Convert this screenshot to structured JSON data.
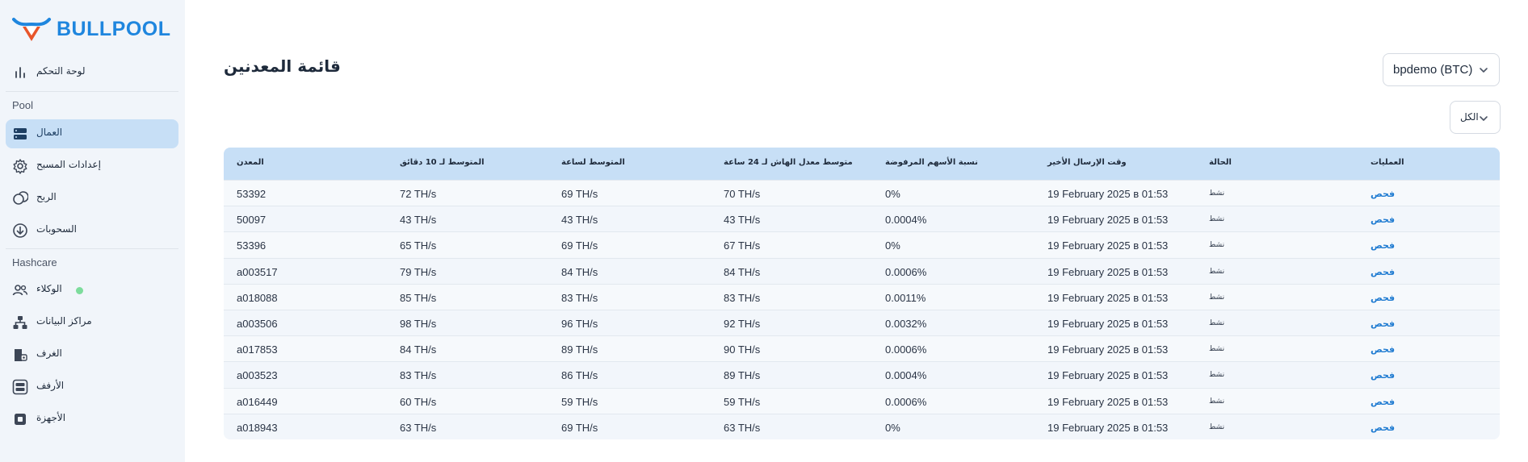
{
  "brand": {
    "name": "BULLPOOL"
  },
  "sidebar": {
    "dashboard": "لوحة التحكم",
    "pool_section": "Pool",
    "pool_items": [
      {
        "label": "العمال",
        "icon": "workers-icon",
        "active": true
      },
      {
        "label": "إعدادات المسبح",
        "icon": "gear-icon",
        "active": false
      },
      {
        "label": "الربح",
        "icon": "coins-icon",
        "active": false
      },
      {
        "label": "السحوبات",
        "icon": "download-circle-icon",
        "active": false
      }
    ],
    "hashcare_section": "Hashcare",
    "hashcare_items": [
      {
        "label": "الوكلاء",
        "icon": "users-icon",
        "status": "online"
      },
      {
        "label": "مراكز البيانات",
        "icon": "datacenter-icon"
      },
      {
        "label": "الغرف",
        "icon": "room-icon"
      },
      {
        "label": "الأرفف",
        "icon": "rack-icon"
      },
      {
        "label": "الأجهزة",
        "icon": "chip-icon"
      }
    ]
  },
  "header": {
    "title": "قائمة المعدنين",
    "pool_select": "bpdemo (BTC)",
    "filter_select": "الكل"
  },
  "table": {
    "columns": [
      "المعدن",
      "المتوسط لـ 10 دقائق",
      "المتوسط لساعة",
      "متوسط معدل الهاش لـ 24 ساعة",
      "نسبة الأسهم المرفوضة",
      "وقت الإرسال الأخير",
      "الحالة",
      "العمليات"
    ],
    "rows": [
      [
        "53392",
        "72 TH/s",
        "69 TH/s",
        "70 TH/s",
        "0%",
        "19 February 2025 в 01:53",
        "نشط",
        "فحص"
      ],
      [
        "50097",
        "43 TH/s",
        "43 TH/s",
        "43 TH/s",
        "0.0004%",
        "19 February 2025 в 01:53",
        "نشط",
        "فحص"
      ],
      [
        "53396",
        "65 TH/s",
        "69 TH/s",
        "67 TH/s",
        "0%",
        "19 February 2025 в 01:53",
        "نشط",
        "فحص"
      ],
      [
        "a003517",
        "79 TH/s",
        "84 TH/s",
        "84 TH/s",
        "0.0006%",
        "19 February 2025 в 01:53",
        "نشط",
        "فحص"
      ],
      [
        "a018088",
        "85 TH/s",
        "83 TH/s",
        "83 TH/s",
        "0.0011%",
        "19 February 2025 в 01:53",
        "نشط",
        "فحص"
      ],
      [
        "a003506",
        "98 TH/s",
        "96 TH/s",
        "92 TH/s",
        "0.0032%",
        "19 February 2025 в 01:53",
        "نشط",
        "فحص"
      ],
      [
        "a017853",
        "84 TH/s",
        "89 TH/s",
        "90 TH/s",
        "0.0006%",
        "19 February 2025 в 01:53",
        "نشط",
        "فحص"
      ],
      [
        "a003523",
        "83 TH/s",
        "86 TH/s",
        "89 TH/s",
        "0.0004%",
        "19 February 2025 в 01:53",
        "نشط",
        "فحص"
      ],
      [
        "a016449",
        "60 TH/s",
        "59 TH/s",
        "59 TH/s",
        "0.0006%",
        "19 February 2025 в 01:53",
        "نشط",
        "فحص"
      ],
      [
        "a018943",
        "63 TH/s",
        "69 TH/s",
        "63 TH/s",
        "0%",
        "19 February 2025 в 01:53",
        "نشط",
        "فحص"
      ]
    ]
  },
  "colors": {
    "accent": "#1f86de",
    "sidebar_bg": "#f1f5fa",
    "active_item_bg": "#c7dff6",
    "table_header_bg": "#c7dff6",
    "status_online": "#7ddc9c"
  }
}
